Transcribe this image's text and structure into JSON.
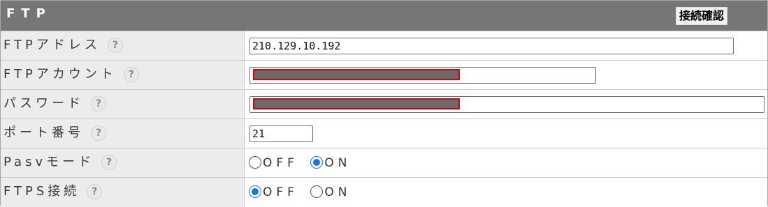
{
  "header": {
    "title": "FTP",
    "connect_button": "接続確認"
  },
  "help_icon": "?",
  "rows": [
    {
      "label": "FTPアドレス",
      "value": "210.129.10.192"
    },
    {
      "label": "FTPアカウント",
      "value": ""
    },
    {
      "label": "パスワード",
      "value": ""
    },
    {
      "label": "ポート番号",
      "value": "21"
    },
    {
      "label": "Pasvモード",
      "options": [
        "OFF",
        "ON"
      ],
      "selected": "ON"
    },
    {
      "label": "FTPS接続",
      "options": [
        "OFF",
        "ON"
      ],
      "selected": "OFF"
    }
  ],
  "colors": {
    "header_bg": "#767676",
    "label_bg": "#ececec",
    "redaction_border": "#e00000",
    "radio_accent": "#1a73e8"
  }
}
